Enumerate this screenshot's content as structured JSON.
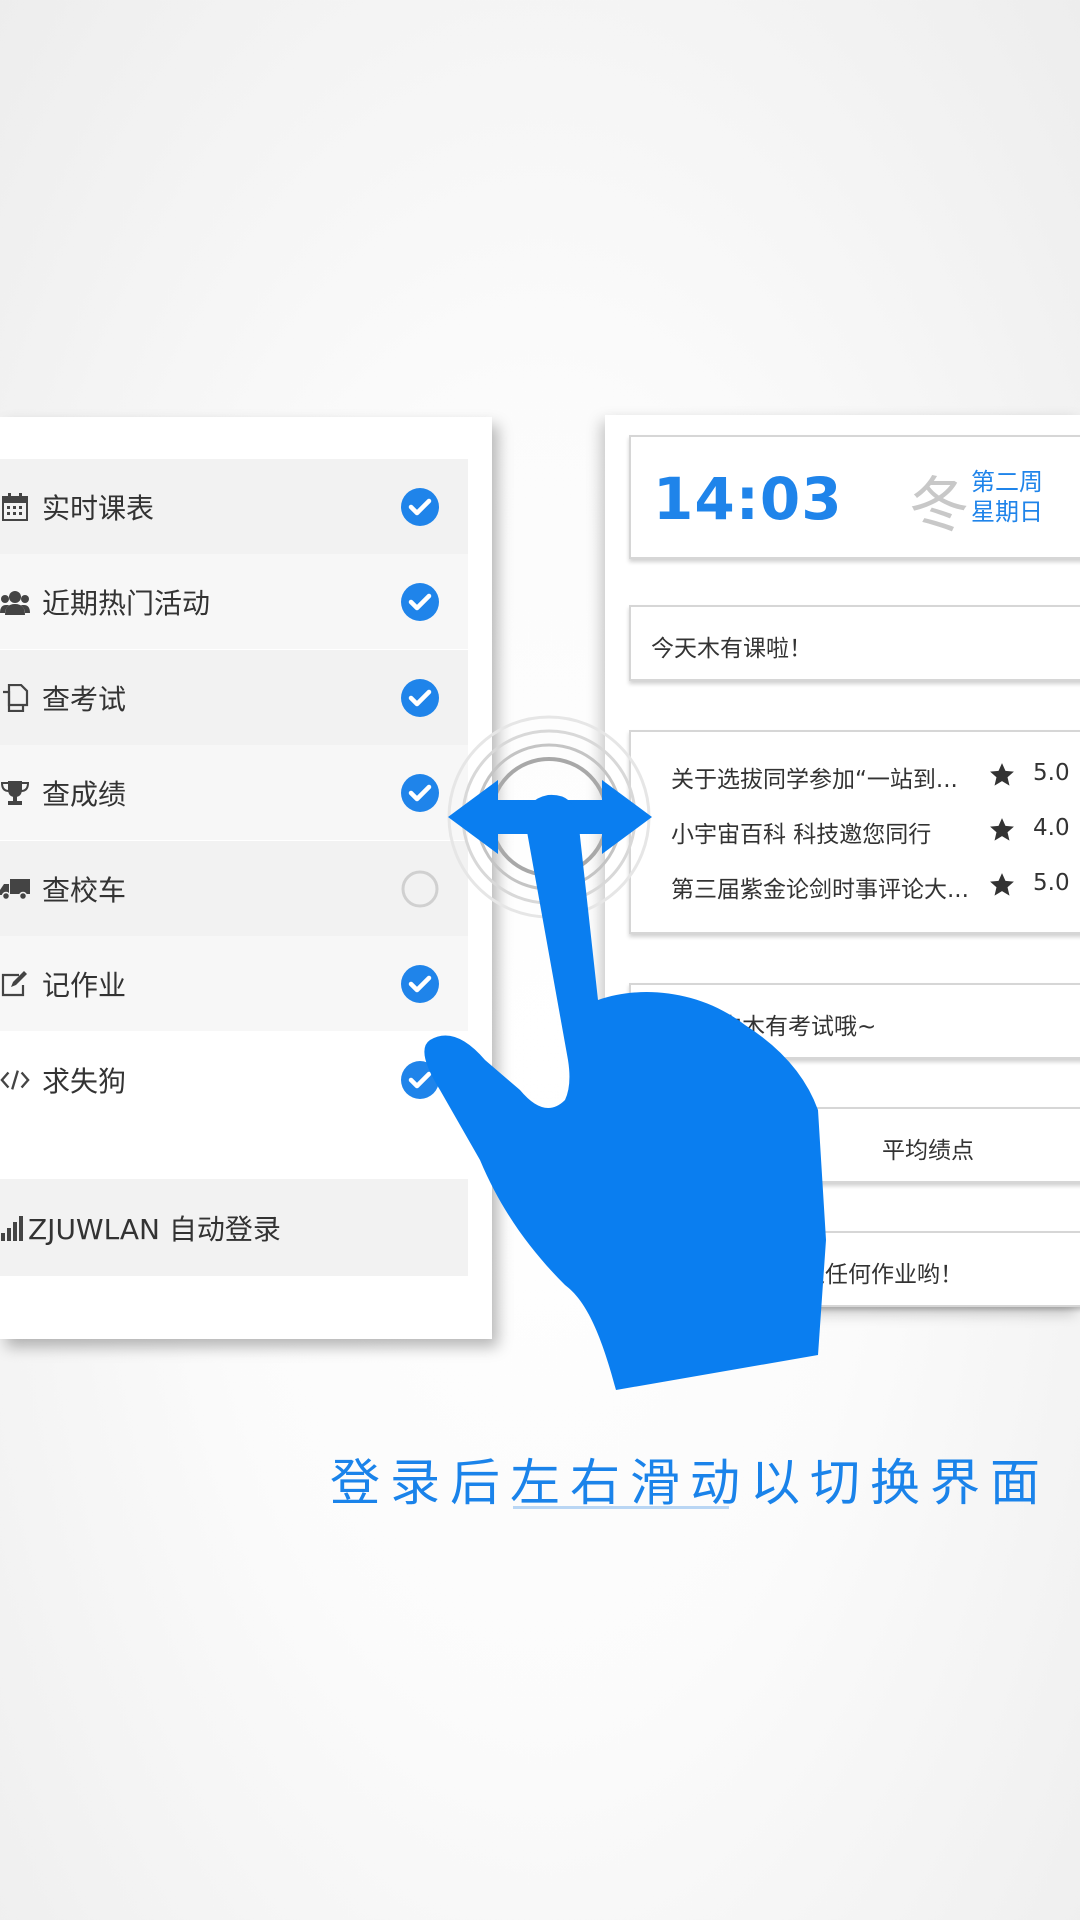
{
  "left_menu": {
    "items": [
      {
        "label": "实时课表",
        "icon": "calendar-icon",
        "checked": true
      },
      {
        "label": "近期热门活动",
        "icon": "users-icon",
        "checked": true
      },
      {
        "label": "查考试",
        "icon": "copy-icon",
        "checked": true
      },
      {
        "label": "查成绩",
        "icon": "trophy-icon",
        "checked": true
      },
      {
        "label": "查校车",
        "icon": "truck-icon",
        "checked": false
      },
      {
        "label": "记作业",
        "icon": "edit-icon",
        "checked": true
      },
      {
        "label": "求失狗",
        "icon": "code-icon",
        "checked": true
      }
    ],
    "wlan": {
      "label": "ZJUWLAN 自动登录",
      "icon": "signal-icon"
    }
  },
  "right_panel": {
    "clock": {
      "time": "14:03",
      "season": "冬",
      "week": "第二周",
      "day": "星期日"
    },
    "schedule_text": "今天木有课啦！",
    "activities": [
      {
        "title": "关于选拔同学参加“一站到...",
        "score": "5.0"
      },
      {
        "title": "小宇宙百科 科技邀您同行",
        "score": "4.0"
      },
      {
        "title": "第三届紫金论剑时事评论大...",
        "score": "5.0"
      }
    ],
    "exam_text": "天以内木有考试哦~",
    "gpa_text": "平均绩点",
    "homework_text": "过任何作业哟！"
  },
  "caption": "登录后左右滑动以切换界面",
  "colors": {
    "accent": "#1f84ea",
    "hand": "#0a7ef0",
    "unchecked": "#d0d0d0"
  }
}
